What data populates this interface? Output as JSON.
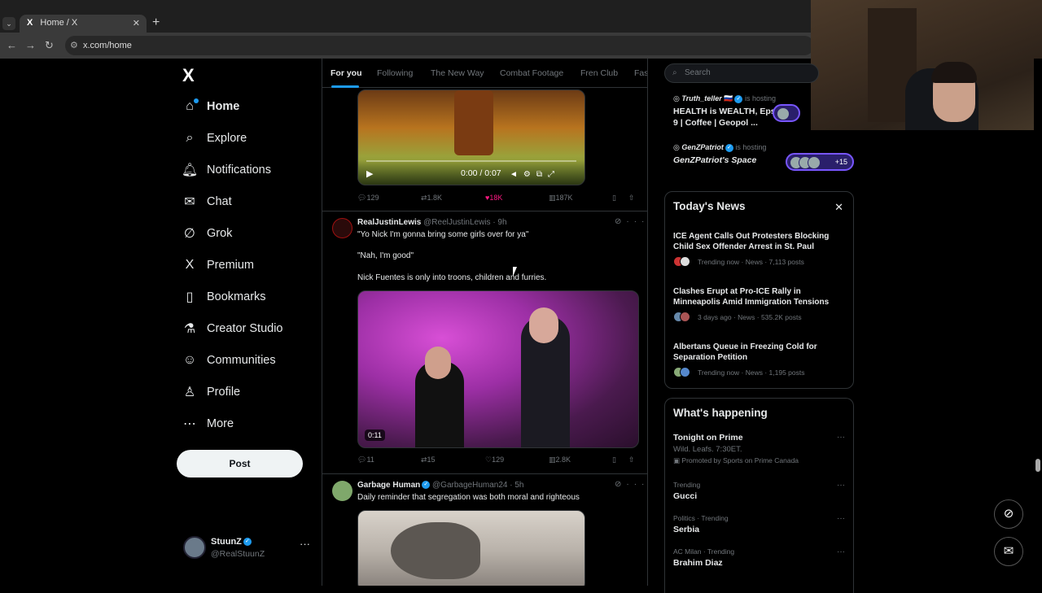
{
  "browser": {
    "tab_title": "Home / X",
    "tab_favicon": "X",
    "url": "x.com/home"
  },
  "nav": {
    "logo": "X",
    "items": [
      {
        "label": "Home",
        "icon": "home-icon",
        "glyph": "⌂"
      },
      {
        "label": "Explore",
        "icon": "search-icon",
        "glyph": "⌕"
      },
      {
        "label": "Notifications",
        "icon": "bell-icon",
        "glyph": "♫"
      },
      {
        "label": "Chat",
        "icon": "mail-icon",
        "glyph": "✉"
      },
      {
        "label": "Grok",
        "icon": "grok-icon",
        "glyph": "∅"
      },
      {
        "label": "Premium",
        "icon": "x-icon",
        "glyph": "X"
      },
      {
        "label": "Bookmarks",
        "icon": "bookmark-icon",
        "glyph": "▯"
      },
      {
        "label": "Creator Studio",
        "icon": "flask-icon",
        "glyph": "⚗"
      },
      {
        "label": "Communities",
        "icon": "people-icon",
        "glyph": "☺"
      },
      {
        "label": "Profile",
        "icon": "person-icon",
        "glyph": "♙"
      },
      {
        "label": "More",
        "icon": "more-circle-icon",
        "glyph": "⋯"
      }
    ],
    "post_button": "Post",
    "account": {
      "name": "StuunZ",
      "handle": "@RealStuunZ"
    }
  },
  "feed": {
    "tabs": [
      "For you",
      "Following",
      "The New Way",
      "Combat Footage",
      "Fren Club",
      "Fas"
    ],
    "post0": {
      "video_time": "0:00 / 0:07",
      "replies": "129",
      "reposts": "1.8K",
      "likes": "18K",
      "views": "187K"
    },
    "post1": {
      "name": "RealJustinLewis",
      "handle": "@ReelJustinLewis · 9h",
      "lines": [
        "\"Yo Nick I'm gonna bring some girls over for ya\"",
        "\"Nah, I'm good\"",
        "Nick Fuentes is only into troons, children and furries."
      ],
      "video_duration": "0:11",
      "replies": "11",
      "reposts": "15",
      "likes": "129",
      "views": "2.8K"
    },
    "post2": {
      "name": "Garbage Human",
      "handle": "@GarbageHuman24 · 5h",
      "text": "Daily reminder that segregation was both moral and righteous"
    }
  },
  "right": {
    "search_placeholder": "Search",
    "spaces": [
      {
        "host": "Truth_teller",
        "flag": "🇷🇺",
        "hosting": "is hosting",
        "title": "HEALTH is WEALTH, Eps. 9 | Coffee | Geopol ...",
        "count": ""
      },
      {
        "host": "GenZPatriot",
        "flag": "",
        "hosting": "is hosting",
        "title": "GenZPatriot's Space",
        "count": "+15"
      }
    ],
    "news": {
      "title": "Today's News",
      "items": [
        {
          "headline": "ICE Agent Calls Out Protesters Blocking Child Sex Offender Arrest in St. Paul",
          "meta": "Trending now · News · 7,113 posts"
        },
        {
          "headline": "Clashes Erupt at Pro-ICE Rally in Minneapolis Amid Immigration Tensions",
          "meta": "3 days ago · News · 535.2K posts"
        },
        {
          "headline": "Albertans Queue in Freezing Cold for Separation Petition",
          "meta": "Trending now · News · 1,195 posts"
        }
      ]
    },
    "happening": {
      "title": "What's happening",
      "promo": {
        "title": "Tonight on Prime",
        "sub": "Wild. Leafs. 7:30ET.",
        "promoted": "Promoted by Sports on Prime Canada"
      },
      "trends": [
        {
          "context": "Trending",
          "name": "Gucci"
        },
        {
          "context": "Politics · Trending",
          "name": "Serbia"
        },
        {
          "context": "AC Milan · Trending",
          "name": "Brahim Diaz"
        }
      ]
    }
  },
  "colors": {
    "accent": "#1d9bf0",
    "like": "#f91880",
    "spaces": "#7856ff"
  }
}
